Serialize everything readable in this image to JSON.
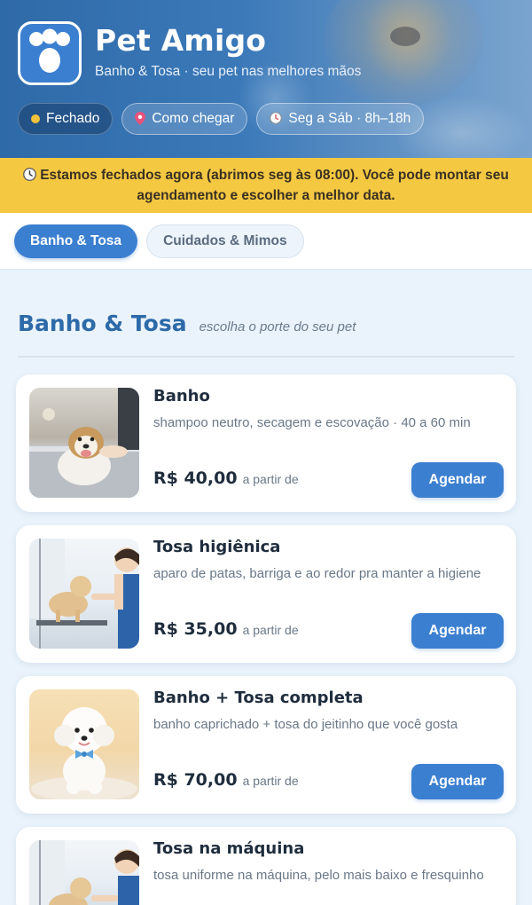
{
  "header": {
    "title": "Pet Amigo",
    "subtitle": "Banho & Tosa · seu pet nas melhores mãos",
    "chips": [
      {
        "label": "Fechado",
        "icon": "status-dot",
        "color": "#f2c23a"
      },
      {
        "label": "Como chegar",
        "icon": "pin-icon"
      },
      {
        "label": "Seg a Sáb · 8h–18h",
        "icon": "clock-icon"
      }
    ]
  },
  "notice": {
    "icon": "clock-icon",
    "text": "Estamos fechados agora (abrimos seg às 08:00). Você pode montar seu agendamento e escolher a melhor data."
  },
  "tabs": [
    {
      "label": "Banho & Tosa",
      "active": true
    },
    {
      "label": "Cuidados & Mimos",
      "active": false
    }
  ],
  "section": {
    "title": "Banho & Tosa",
    "subtitle": "escolha o porte do seu pet"
  },
  "services": [
    {
      "title": "Banho",
      "desc": "shampoo neutro, secagem e escovação · 40 a 60 min",
      "price": "R$ 40,00",
      "price_note": "a partir de",
      "button": "Agendar"
    },
    {
      "title": "Tosa higiênica",
      "desc": "aparo de patas, barriga e ao redor pra manter a higiene",
      "price": "R$ 35,00",
      "price_note": "a partir de",
      "button": "Agendar"
    },
    {
      "title": "Banho + Tosa completa",
      "desc": "banho caprichado + tosa do jeitinho que você gosta",
      "price": "R$ 70,00",
      "price_note": "a partir de",
      "button": "Agendar"
    },
    {
      "title": "Tosa na máquina",
      "desc": "tosa uniforme na máquina, pelo mais baixo e fresquinho",
      "price": "",
      "price_note": "",
      "button": ""
    }
  ],
  "colors": {
    "primary": "#3b7fd0",
    "notice_bg": "#f5c842",
    "section_title": "#2d6aa8",
    "page_bg": "#eaf3fb"
  }
}
